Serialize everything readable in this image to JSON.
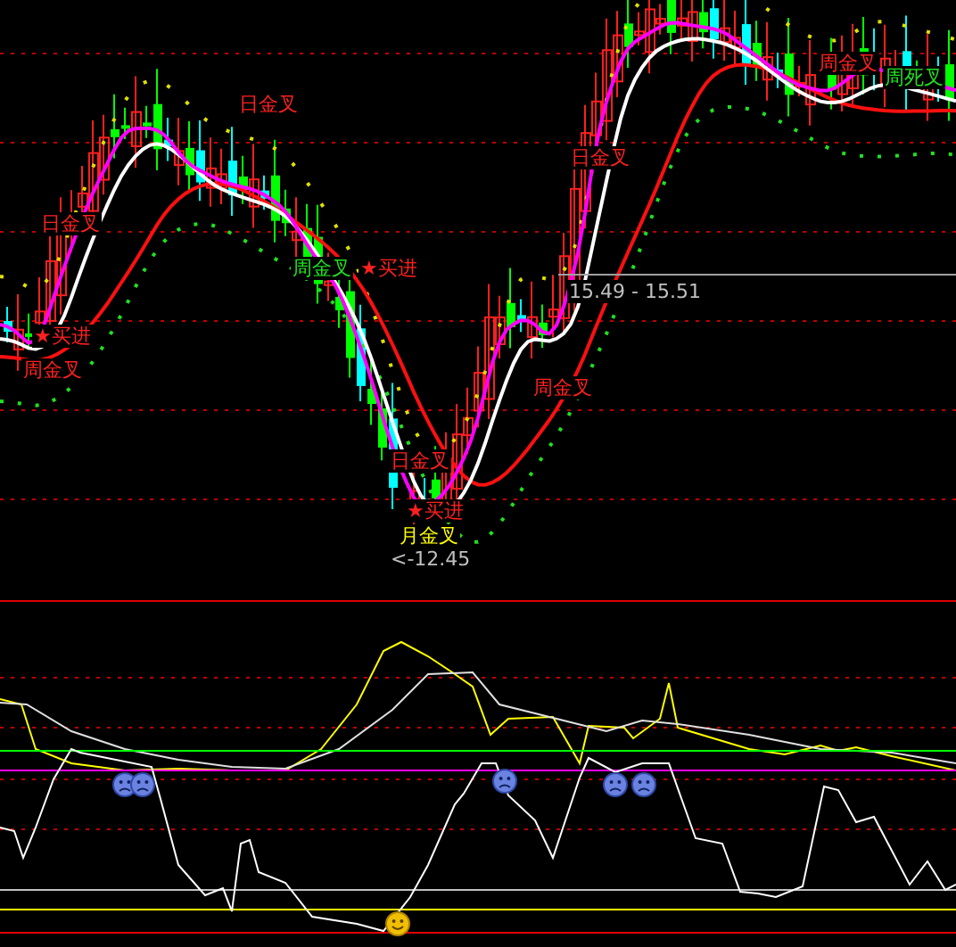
{
  "main_chart": {
    "labels": [
      {
        "text": "日金叉",
        "color": "#ff2020"
      },
      {
        "text": "日金叉",
        "color": "#ff2020"
      },
      {
        "text": "周金叉",
        "color": "#20e020"
      },
      {
        "text": "★买进",
        "color": "#ff2020"
      },
      {
        "text": "★买进",
        "color": "#ff2020"
      },
      {
        "text": "周金叉",
        "color": "#ff2020"
      },
      {
        "text": "日金叉",
        "color": "#ff2020"
      },
      {
        "text": "★买进",
        "color": "#ff2020"
      },
      {
        "text": "月金叉",
        "color": "#ffff00"
      },
      {
        "text": "<-12.45",
        "color": "#c0c0c0"
      },
      {
        "text": "日金叉",
        "color": "#ff2020"
      },
      {
        "text": "15.49 - 15.51",
        "color": "#c0c0c0"
      },
      {
        "text": "周金叉",
        "color": "#ff2020"
      },
      {
        "text": "周金叉",
        "color": "#ff2020"
      },
      {
        "text": "周死叉",
        "color": "#20e020"
      }
    ]
  },
  "indicator": {
    "markers": [
      {
        "kind": "sad"
      },
      {
        "kind": "sad"
      },
      {
        "kind": "sad"
      },
      {
        "kind": "sad"
      },
      {
        "kind": "sad"
      },
      {
        "kind": "happy"
      }
    ]
  }
}
